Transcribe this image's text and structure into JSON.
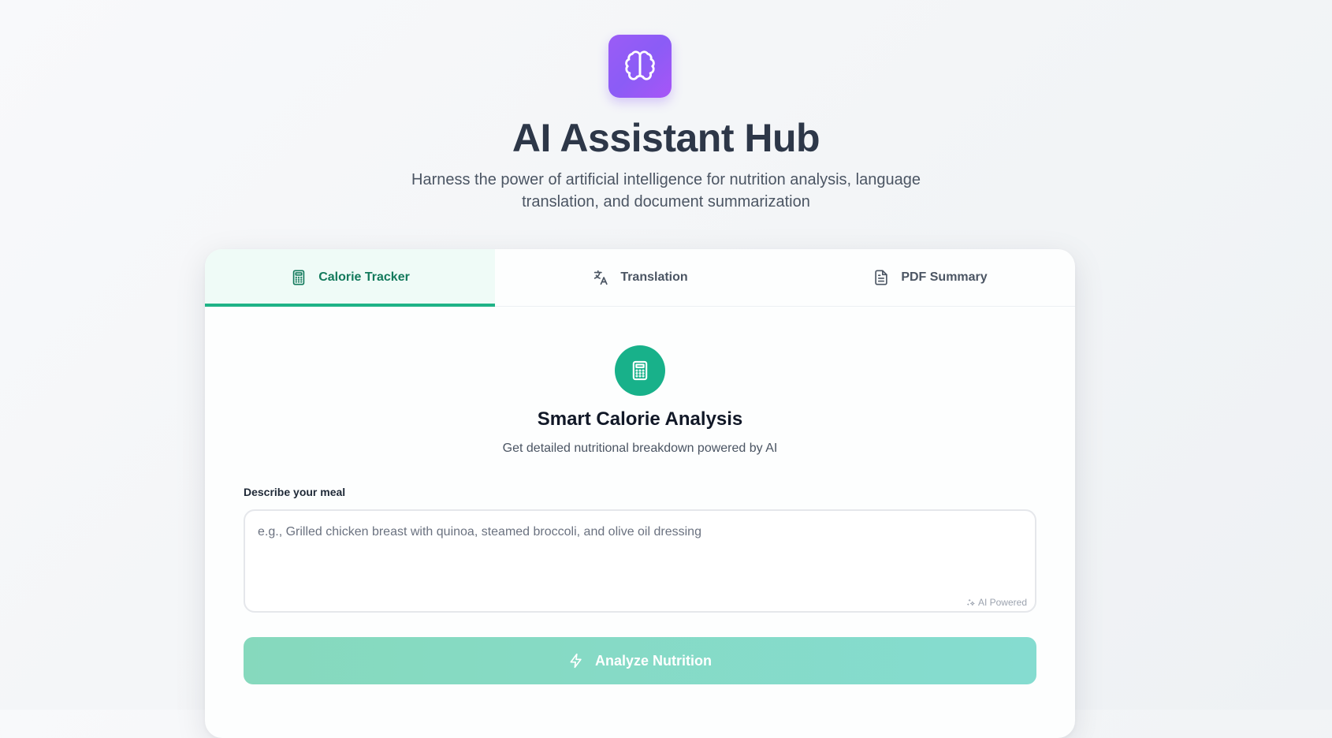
{
  "header": {
    "logo_icon": "brain-icon",
    "title": "AI Assistant Hub",
    "subtitle": "Harness the power of artificial intelligence for nutrition analysis, language translation, and document summarization"
  },
  "tabs": [
    {
      "label": "Calorie Tracker",
      "icon": "calculator-icon",
      "active": true
    },
    {
      "label": "Translation",
      "icon": "translate-icon",
      "active": false
    },
    {
      "label": "PDF Summary",
      "icon": "document-icon",
      "active": false
    }
  ],
  "calorie": {
    "icon": "calculator-icon",
    "title": "Smart Calorie Analysis",
    "subtitle": "Get detailed nutritional breakdown powered by AI",
    "field_label": "Describe your meal",
    "placeholder": "e.g., Grilled chicken breast with quinoa, steamed broccoli, and olive oil dressing",
    "value": "",
    "badge": "AI Powered",
    "button_label": "Analyze Nutrition",
    "button_icon": "lightning-icon"
  },
  "colors": {
    "logo": "#8b5cf6",
    "accent": "#1fb387",
    "accent_dark": "#137a5c",
    "button": "#86d9bd"
  }
}
